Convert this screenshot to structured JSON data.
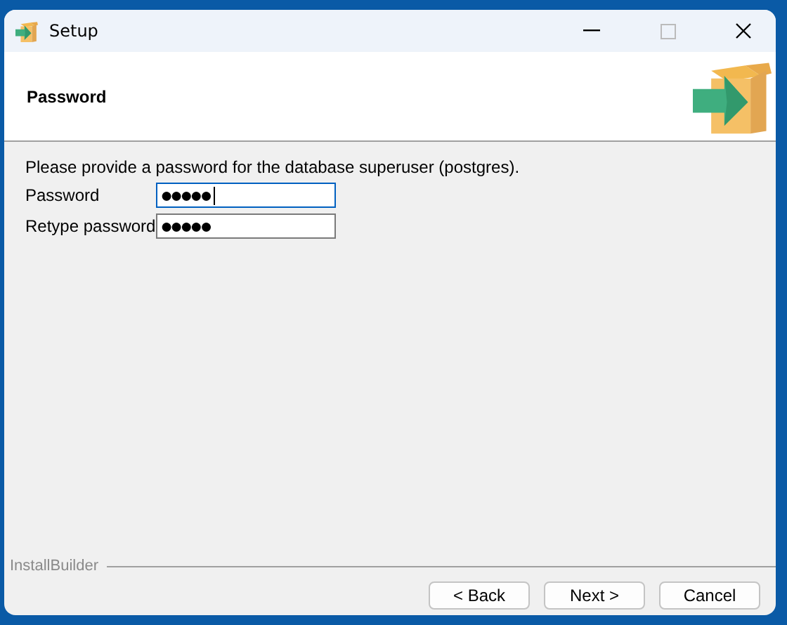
{
  "window": {
    "title": "Setup"
  },
  "header": {
    "title": "Password"
  },
  "intro": "Please provide a password for the database superuser (postgres).",
  "fields": [
    {
      "label": "Password",
      "value": "●●●●●",
      "focused": true
    },
    {
      "label": "Retype password",
      "value": "●●●●●",
      "focused": false
    }
  ],
  "footer": {
    "brand": "InstallBuilder"
  },
  "buttons": [
    "< Back",
    "Next >",
    "Cancel"
  ]
}
